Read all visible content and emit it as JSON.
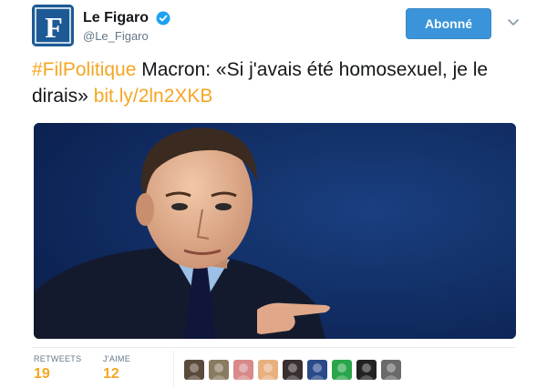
{
  "account": {
    "display_name": "Le Figaro",
    "handle": "@Le_Figaro",
    "avatar_letter": "F",
    "avatar_color": "#1d5a95",
    "verified_color": "#1da1f2"
  },
  "follow_button": {
    "label": "Abonné",
    "color": "#3b94d9"
  },
  "tweet": {
    "hashtag": "#FilPolitique",
    "text_main": " Macron: «Si j'avais été homosexuel, je le dirais» ",
    "link": "bit.ly/2ln2XKB",
    "accent_color": "#f5a623"
  },
  "photo": {
    "subject": "man-in-suit-pointing",
    "background_color": "#102e63"
  },
  "stats": {
    "retweets_label": "RETWEETS",
    "retweets_value": "19",
    "likes_label": "J'AIME",
    "likes_value": "12"
  },
  "likers": [
    {
      "name": "liker-avatar-1",
      "color": "#5a4a3a"
    },
    {
      "name": "liker-avatar-2",
      "color": "#8a7a60"
    },
    {
      "name": "liker-avatar-3",
      "color": "#d88a8a"
    },
    {
      "name": "liker-avatar-4",
      "color": "#e8b080"
    },
    {
      "name": "liker-avatar-5",
      "color": "#3a3030"
    },
    {
      "name": "liker-avatar-6",
      "color": "#2a4a8a"
    },
    {
      "name": "liker-avatar-7",
      "color": "#2aa54a"
    },
    {
      "name": "liker-avatar-8",
      "color": "#222222"
    },
    {
      "name": "liker-avatar-9",
      "color": "#6a6a6a"
    }
  ]
}
